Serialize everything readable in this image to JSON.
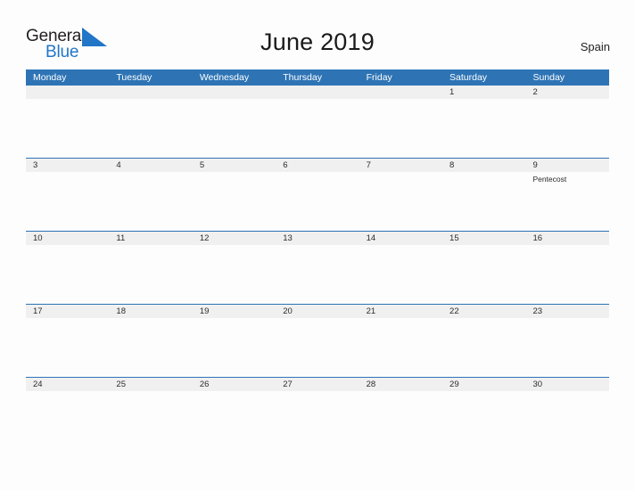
{
  "brand": {
    "name_part1": "General",
    "name_part2": "Blue",
    "flag_icon": "blue-triangle-flag-icon",
    "color_dark": "#231f20",
    "color_blue": "#2176c7"
  },
  "header": {
    "title": "June 2019",
    "region": "Spain"
  },
  "calendar": {
    "accent_color": "#2e74b5",
    "date_band_color": "#f0f0f0",
    "day_headers": [
      "Monday",
      "Tuesday",
      "Wednesday",
      "Thursday",
      "Friday",
      "Saturday",
      "Sunday"
    ],
    "weeks": [
      {
        "days": [
          {
            "date": "",
            "events": []
          },
          {
            "date": "",
            "events": []
          },
          {
            "date": "",
            "events": []
          },
          {
            "date": "",
            "events": []
          },
          {
            "date": "",
            "events": []
          },
          {
            "date": "1",
            "events": []
          },
          {
            "date": "2",
            "events": []
          }
        ]
      },
      {
        "days": [
          {
            "date": "3",
            "events": []
          },
          {
            "date": "4",
            "events": []
          },
          {
            "date": "5",
            "events": []
          },
          {
            "date": "6",
            "events": []
          },
          {
            "date": "7",
            "events": []
          },
          {
            "date": "8",
            "events": []
          },
          {
            "date": "9",
            "events": [
              "Pentecost"
            ]
          }
        ]
      },
      {
        "days": [
          {
            "date": "10",
            "events": []
          },
          {
            "date": "11",
            "events": []
          },
          {
            "date": "12",
            "events": []
          },
          {
            "date": "13",
            "events": []
          },
          {
            "date": "14",
            "events": []
          },
          {
            "date": "15",
            "events": []
          },
          {
            "date": "16",
            "events": []
          }
        ]
      },
      {
        "days": [
          {
            "date": "17",
            "events": []
          },
          {
            "date": "18",
            "events": []
          },
          {
            "date": "19",
            "events": []
          },
          {
            "date": "20",
            "events": []
          },
          {
            "date": "21",
            "events": []
          },
          {
            "date": "22",
            "events": []
          },
          {
            "date": "23",
            "events": []
          }
        ]
      },
      {
        "days": [
          {
            "date": "24",
            "events": []
          },
          {
            "date": "25",
            "events": []
          },
          {
            "date": "26",
            "events": []
          },
          {
            "date": "27",
            "events": []
          },
          {
            "date": "28",
            "events": []
          },
          {
            "date": "29",
            "events": []
          },
          {
            "date": "30",
            "events": []
          }
        ]
      }
    ]
  }
}
